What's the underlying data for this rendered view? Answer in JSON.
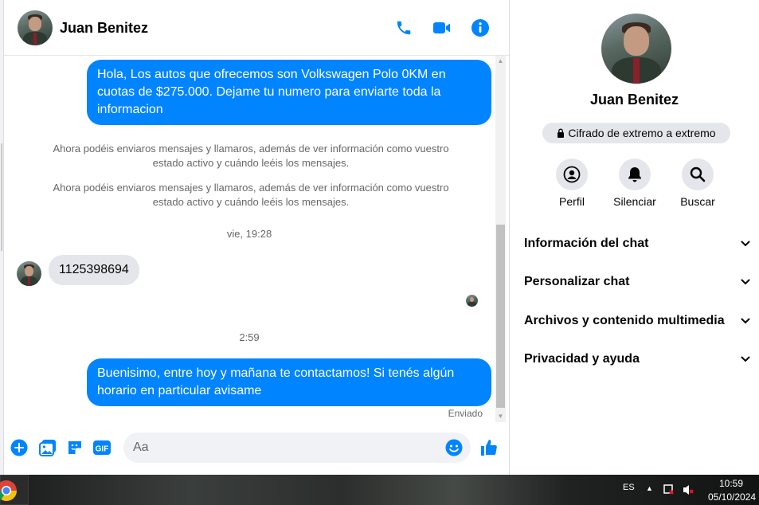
{
  "contact": {
    "name": "Juan Benitez"
  },
  "header_actions": [
    "phone-icon",
    "video-icon",
    "info-icon"
  ],
  "messages": {
    "msg1": "Hola, Los autos que ofrecemos son Volkswagen Polo 0KM en cuotas de $275.000. Dejame tu numero para enviarte toda la informacion",
    "sys1": "Ahora podéis enviaros mensajes y llamaros, además de ver información como vuestro estado activo y cuándo leéis los mensajes.",
    "sys2": "Ahora podéis enviaros mensajes y llamaros, además de ver información como vuestro estado activo y cuándo leéis los mensajes.",
    "ts1": "vie, 19:28",
    "msg2": "1125398694",
    "ts2": "2:59",
    "msg3": "Buenisimo, entre hoy y mañana te contactamos! Si tenés algún horario en particular avisame",
    "status": "Enviado"
  },
  "composer": {
    "placeholder": "Aa",
    "icons": [
      "plus-icon",
      "image-icon",
      "sticker-icon",
      "gif-icon",
      "emoji-icon",
      "like-icon"
    ],
    "gif_label": "GIF"
  },
  "info_panel": {
    "name": "Juan Benitez",
    "encryption_badge": "Cifrado de extremo a extremo",
    "actions": [
      "Perfil",
      "Silenciar",
      "Buscar"
    ],
    "sections": [
      "Información del chat",
      "Personalizar chat",
      "Archivos y contenido multimedia",
      "Privacidad y ayuda"
    ]
  },
  "taskbar": {
    "language": "ES",
    "time": "10:59",
    "date": "05/10/2024"
  },
  "colors": {
    "accent": "#0084ff",
    "bubble_in": "#e4e6eb",
    "muted_text": "#65676b"
  }
}
